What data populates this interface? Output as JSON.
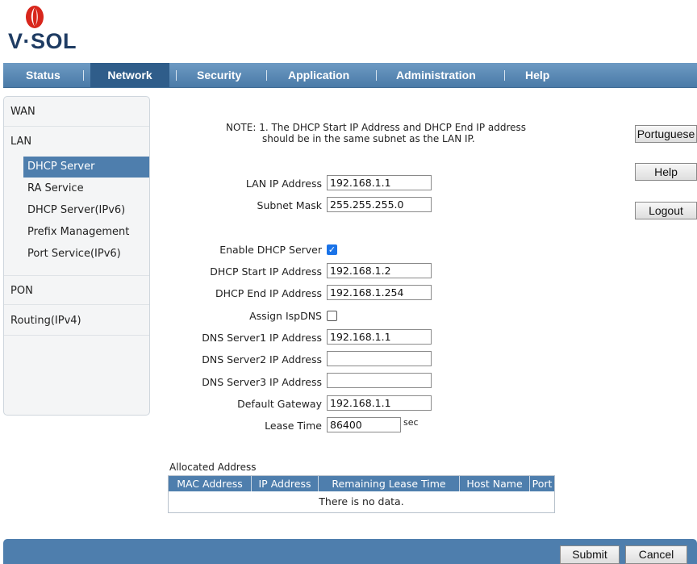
{
  "brand": {
    "logo_text": "V·SOL",
    "logo_color": "#1f3c63",
    "mark_color": "#d8261c"
  },
  "nav": {
    "items": [
      {
        "label": "Status",
        "active": false
      },
      {
        "label": "Network",
        "active": true
      },
      {
        "label": "Security",
        "active": false
      },
      {
        "label": "Application",
        "active": false
      },
      {
        "label": "Administration",
        "active": false
      },
      {
        "label": "Help",
        "active": false
      }
    ]
  },
  "sidebar": {
    "wan": "WAN",
    "lan": "LAN",
    "lan_items": [
      "DHCP Server",
      "RA Service",
      "DHCP Server(IPv6)",
      "Prefix Management",
      "Port Service(IPv6)"
    ],
    "active_item": "DHCP Server",
    "pon": "PON",
    "routing": "Routing(IPv4)"
  },
  "note": {
    "line1": "NOTE: 1. The DHCP Start IP Address and DHCP End IP address",
    "line2": "should be in the same subnet as the LAN IP."
  },
  "form": {
    "lan_ip_label": "LAN IP Address",
    "lan_ip_value": "192.168.1.1",
    "subnet_label": "Subnet Mask",
    "subnet_value": "255.255.255.0",
    "enable_dhcp_label": "Enable DHCP Server",
    "enable_dhcp_checked": true,
    "start_ip_label": "DHCP Start IP Address",
    "start_ip_value": "192.168.1.2",
    "end_ip_label": "DHCP End IP Address",
    "end_ip_value": "192.168.1.254",
    "assign_ispdns_label": "Assign IspDNS",
    "assign_ispdns_checked": false,
    "dns1_label": "DNS Server1 IP Address",
    "dns1_value": "192.168.1.1",
    "dns2_label": "DNS Server2 IP Address",
    "dns2_value": "",
    "dns3_label": "DNS Server3 IP Address",
    "dns3_value": "",
    "gateway_label": "Default Gateway",
    "gateway_value": "192.168.1.1",
    "lease_label": "Lease Time",
    "lease_value": "86400",
    "lease_unit": "sec"
  },
  "side_buttons": {
    "portuguese": "Portuguese",
    "help": "Help",
    "logout": "Logout"
  },
  "allocated": {
    "title": "Allocated Address",
    "columns": [
      "MAC Address",
      "IP Address",
      "Remaining Lease Time",
      "Host Name",
      "Port"
    ],
    "empty_text": "There is no data."
  },
  "footer": {
    "submit": "Submit",
    "cancel": "Cancel"
  },
  "colors": {
    "nav_bg": "#4a7aa7",
    "active_bg": "#2f5d8a",
    "accent": "#4e7ead"
  }
}
